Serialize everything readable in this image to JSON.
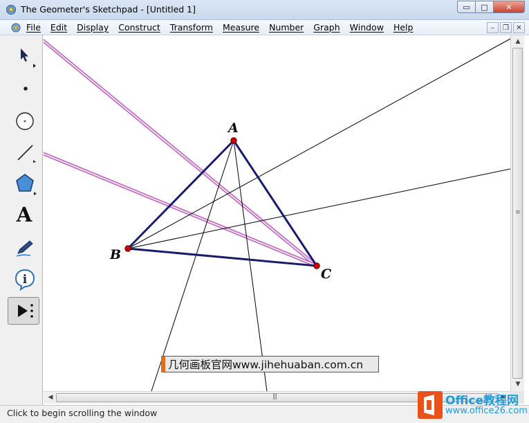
{
  "window": {
    "title": "The Geometer's Sketchpad - [Untitled 1]",
    "buttons": {
      "minimize": "▭",
      "maximize": "□",
      "close": "✕"
    }
  },
  "menubar": {
    "items": [
      "File",
      "Edit",
      "Display",
      "Construct",
      "Transform",
      "Measure",
      "Number",
      "Graph",
      "Window",
      "Help"
    ],
    "mdi_buttons": {
      "minimize": "–",
      "restore": "❐",
      "close": "✕"
    }
  },
  "toolbox": {
    "tools": [
      {
        "name": "arrow-tool",
        "icon": "arrow-select-icon"
      },
      {
        "name": "point-tool",
        "icon": "point-icon"
      },
      {
        "name": "compass-tool",
        "icon": "circle-compass-icon"
      },
      {
        "name": "straightedge-tool",
        "icon": "segment-icon"
      },
      {
        "name": "polygon-tool",
        "icon": "pentagon-icon"
      },
      {
        "name": "text-tool",
        "icon": "text-A-icon",
        "glyph": "A"
      },
      {
        "name": "marker-tool",
        "icon": "marker-pen-icon"
      },
      {
        "name": "information-tool",
        "icon": "info-icon",
        "glyph": "i"
      },
      {
        "name": "custom-tool",
        "icon": "play-custom-icon",
        "selected": true
      }
    ]
  },
  "sketch": {
    "points": [
      {
        "label": "A"
      },
      {
        "label": "B"
      },
      {
        "label": "C"
      }
    ],
    "colors": {
      "triangle": "#1a1a6e",
      "point_fill": "#cc0000",
      "highlighted_lines": "#b85ab8",
      "thin_lines": "#000000"
    },
    "watermark_text": "几何画板官网www.jihehuaban.com.cn"
  },
  "status": {
    "text": "Click to begin scrolling the window"
  },
  "overlay_logo": {
    "brand": "Office教程网",
    "url": "www.office26.com",
    "color": "#1f9bd6"
  }
}
